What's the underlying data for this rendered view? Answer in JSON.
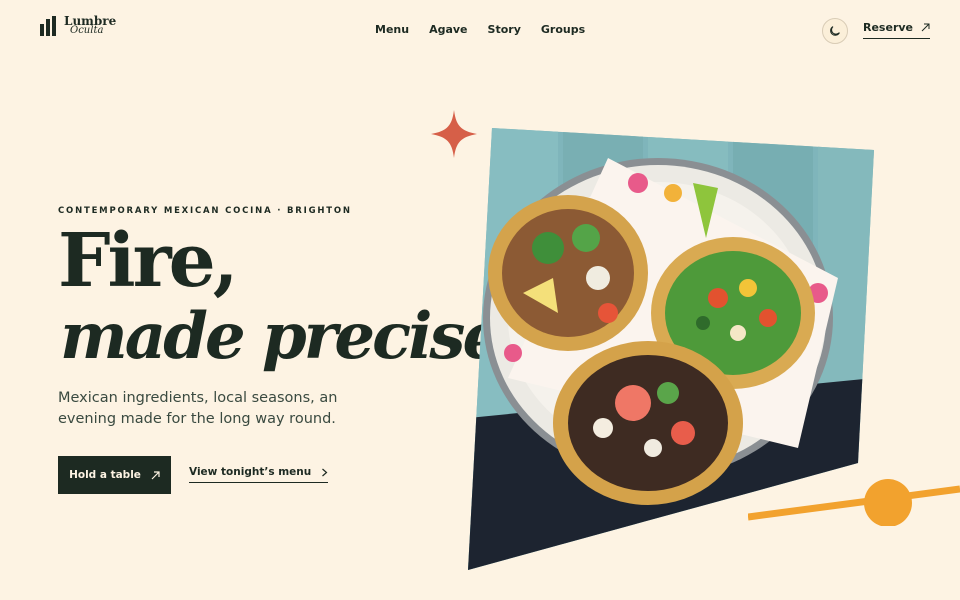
{
  "brand": {
    "line1": "Lumbre",
    "line2": "Oculta"
  },
  "nav": {
    "items": [
      "Menu",
      "Agave",
      "Story",
      "Groups"
    ]
  },
  "header": {
    "reserve_label": "Reserve",
    "theme_icon": "moon-icon"
  },
  "hero": {
    "eyebrow": "CONTEMPORARY MEXICAN COCINA · BRIGHTON",
    "title_line1": "Fire,",
    "title_line2": "made precise",
    "lead": "Mexican ingredients, local seasons, an evening made for the long way round.",
    "cta_primary": "Hold a table",
    "cta_secondary": "View tonight’s menu"
  },
  "colors": {
    "background": "#fdf3e3",
    "ink": "#1d2a22",
    "sparkle": "#d65f48",
    "accent_orange": "#f2a22e"
  },
  "icons": {
    "primary_cta": "arrow-up-right-icon",
    "secondary_cta": "chevron-right-icon",
    "reserve": "arrow-up-right-icon"
  }
}
